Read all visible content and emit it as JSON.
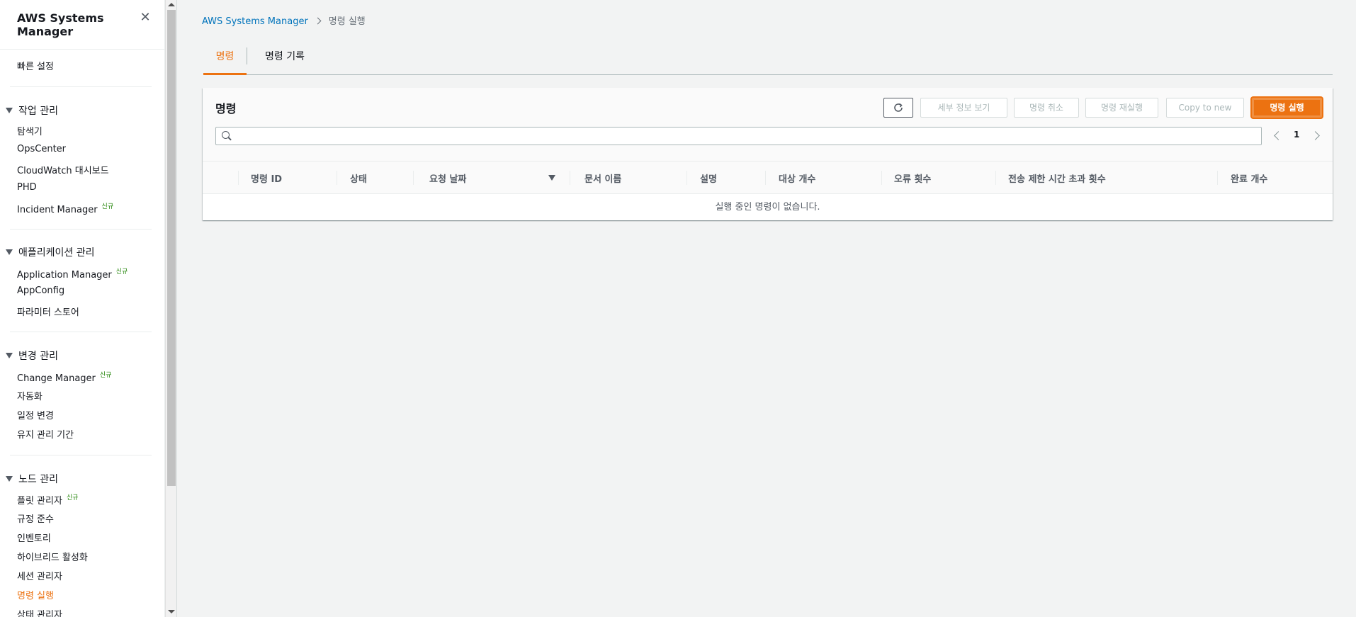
{
  "sidebar": {
    "title": "AWS Systems Manager",
    "quick_setup": "빠른 설정",
    "groups": [
      {
        "label": "작업 관리",
        "items": [
          {
            "label": "탐색기",
            "new": ""
          },
          {
            "label": "OpsCenter",
            "new": ""
          },
          {
            "label": "CloudWatch 대시보드",
            "new": ""
          },
          {
            "label": "PHD",
            "new": ""
          },
          {
            "label": "Incident Manager",
            "new": "신규"
          }
        ]
      },
      {
        "label": "애플리케이션 관리",
        "items": [
          {
            "label": "Application Manager",
            "new": "신규"
          },
          {
            "label": "AppConfig",
            "new": ""
          },
          {
            "label": "파라미터 스토어",
            "new": ""
          }
        ]
      },
      {
        "label": "변경 관리",
        "items": [
          {
            "label": "Change Manager",
            "new": "신규"
          },
          {
            "label": "자동화",
            "new": ""
          },
          {
            "label": "일정 변경",
            "new": ""
          },
          {
            "label": "유지 관리 기간",
            "new": ""
          }
        ]
      },
      {
        "label": "노드 관리",
        "items": [
          {
            "label": "플릿 관리자",
            "new": "신규"
          },
          {
            "label": "규정 준수",
            "new": ""
          },
          {
            "label": "인벤토리",
            "new": ""
          },
          {
            "label": "하이브리드 활성화",
            "new": ""
          },
          {
            "label": "세션 관리자",
            "new": ""
          },
          {
            "label": "명령 실행",
            "new": ""
          },
          {
            "label": "상태 관리자",
            "new": ""
          }
        ]
      }
    ]
  },
  "breadcrumb": {
    "root": "AWS Systems Manager",
    "current": "명령 실행"
  },
  "tabs": [
    {
      "label": "명령",
      "active": true
    },
    {
      "label": "명령 기록",
      "active": false
    }
  ],
  "panel": {
    "title": "명령",
    "buttons": {
      "refresh_icon": "refresh-icon",
      "view_details": "세부 정보 보기",
      "cancel_command": "명령 취소",
      "rerun": "명령 재실행",
      "copy_to_new": "Copy to new",
      "run_command": "명령 실행"
    },
    "search": {
      "value": "",
      "placeholder": ""
    },
    "pagination": {
      "page": "1"
    },
    "columns": [
      "명령 ID",
      "상태",
      "요청 날짜",
      "문서 이름",
      "설명",
      "대상 개수",
      "오류 횟수",
      "전송 제한 시간 초과 횟수",
      "완료 개수"
    ],
    "empty_message": "실행 중인 명령이 없습니다."
  },
  "colors": {
    "accent": "#ec7211",
    "link": "#0073bb",
    "new_badge": "#1d8102"
  }
}
